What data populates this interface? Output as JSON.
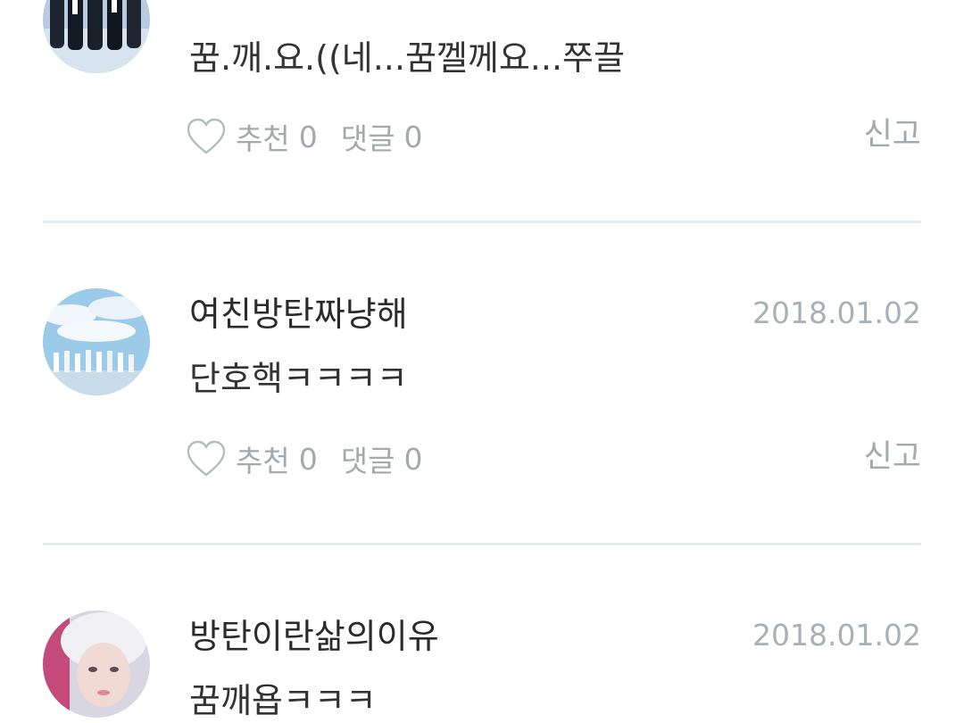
{
  "comments": [
    {
      "author": "",
      "date": "",
      "body": "꿈.깨.요.((네...꿈껠께요...쭈끌",
      "like_label": "추천",
      "like_count": "0",
      "reply_label": "댓글",
      "reply_count": "0",
      "report_label": "신고"
    },
    {
      "author": "여친방탄짜냥해",
      "date": "2018.01.02",
      "body": "단호핵ㅋㅋㅋㅋ",
      "like_label": "추천",
      "like_count": "0",
      "reply_label": "댓글",
      "reply_count": "0",
      "report_label": "신고"
    },
    {
      "author": "방탄이란삶의이유",
      "date": "2018.01.02",
      "body": "꿈깨욥ㅋㅋㅋ"
    }
  ],
  "colors": {
    "divider": "#e3ecee",
    "meta_text": "#a3a9ad",
    "primary_text": "#2b2b2b"
  },
  "icons": {
    "like": "heart-outline-icon"
  }
}
